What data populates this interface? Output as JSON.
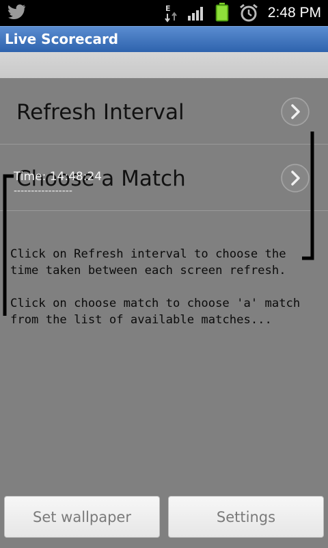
{
  "status_bar": {
    "time": "2:48 PM",
    "icons": [
      "twitter-icon",
      "data-transfer-icon",
      "signal-icon",
      "battery-icon",
      "alarm-icon"
    ]
  },
  "app": {
    "title": "Live Scorecard"
  },
  "preferences": {
    "items": [
      {
        "label": "Refresh Interval"
      },
      {
        "label": "Choose a Match"
      }
    ]
  },
  "overlay": {
    "time_text": "Time: 14:48:24",
    "dashes": "-----------------"
  },
  "help": {
    "paragraph1": "Click on Refresh interval to choose the time taken between each screen refresh.",
    "paragraph2": "Click on choose match to choose 'a' match from the list of available matches..."
  },
  "buttons": {
    "set_wallpaper": "Set wallpaper",
    "settings": "Settings"
  },
  "colors": {
    "title_bar": "#3f73bd",
    "background": "#808080",
    "status_bar": "#000000"
  }
}
